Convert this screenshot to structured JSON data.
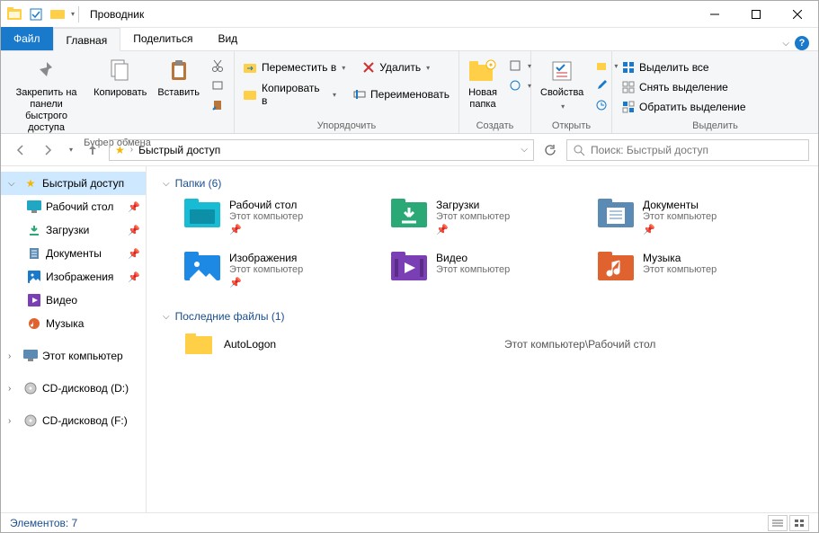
{
  "titlebar": {
    "title": "Проводник"
  },
  "tabs": {
    "file": "Файл",
    "home": "Главная",
    "share": "Поделиться",
    "view": "Вид"
  },
  "ribbon": {
    "clipboard": {
      "pin": "Закрепить на панели\nбыстрого доступа",
      "copy": "Копировать",
      "paste": "Вставить",
      "label": "Буфер обмена"
    },
    "organize": {
      "moveto": "Переместить в",
      "copyto": "Копировать в",
      "delete": "Удалить",
      "rename": "Переименовать",
      "label": "Упорядочить"
    },
    "new": {
      "newfolder": "Новая\nпапка",
      "label": "Создать"
    },
    "open": {
      "properties": "Свойства",
      "label": "Открыть"
    },
    "select": {
      "selectall": "Выделить все",
      "selectnone": "Снять выделение",
      "invert": "Обратить выделение",
      "label": "Выделить"
    }
  },
  "address": {
    "crumb": "Быстрый доступ"
  },
  "search": {
    "placeholder": "Поиск: Быстрый доступ"
  },
  "sidebar": {
    "quick": "Быстрый доступ",
    "desktop": "Рабочий стол",
    "downloads": "Загрузки",
    "documents": "Документы",
    "pictures": "Изображения",
    "videos": "Видео",
    "music": "Музыка",
    "thispc": "Этот компьютер",
    "cd_d": "CD-дисковод (D:)",
    "cd_f": "CD-дисковод (F:)"
  },
  "content": {
    "folders_header": "Папки (6)",
    "recent_header": "Последние файлы (1)",
    "sub": "Этот компьютер",
    "folders": {
      "desktop": "Рабочий стол",
      "downloads": "Загрузки",
      "documents": "Документы",
      "pictures": "Изображения",
      "videos": "Видео",
      "music": "Музыка"
    },
    "recent": {
      "name": "AutoLogon",
      "path": "Этот компьютер\\Рабочий стол"
    }
  },
  "status": {
    "items": "Элементов: 7"
  }
}
